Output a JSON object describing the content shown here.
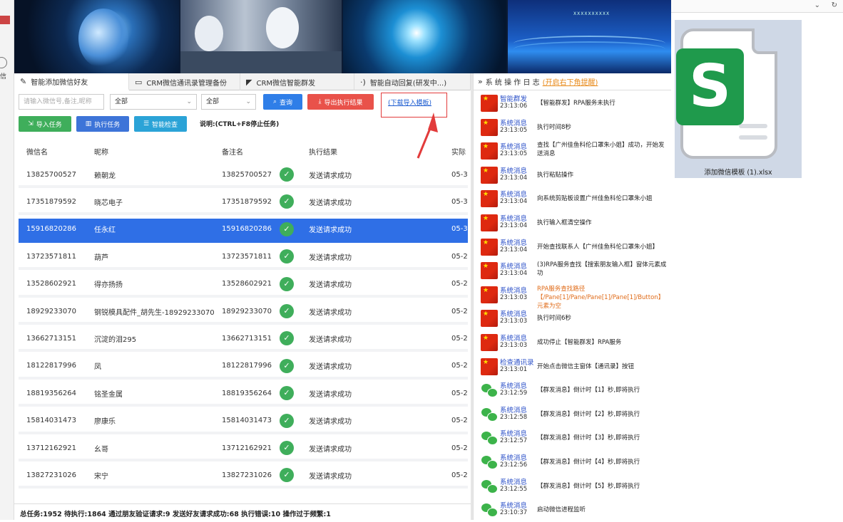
{
  "tabs": [
    {
      "label": "智能添加微信好友",
      "icon": "pencil-icon"
    },
    {
      "label": "CRM微信通讯录管理备份",
      "icon": "book-icon"
    },
    {
      "label": "CRM微信智能群发",
      "icon": "send-icon"
    },
    {
      "label": "智能自动回复(研发中...)",
      "icon": "signal-icon"
    }
  ],
  "toolbar": {
    "search_placeholder": "请输入微信号,备注,昵称",
    "filter1": "全部",
    "filter2": "全部",
    "query": "查询",
    "export": "导出执行结果",
    "download_template": "(下载导入模板)",
    "import": "导入任务",
    "execute": "执行任务",
    "check": "智能检查",
    "hint": "说明:(CTRL+F8停止任务)"
  },
  "grid": {
    "headers": [
      "微信名",
      "昵称",
      "备注名",
      "执行结果",
      "实际"
    ],
    "rows": [
      {
        "wx": "13825700527",
        "nick": "赖朝龙",
        "remark": "13825700527",
        "result": "发送请求成功",
        "time": "05-3"
      },
      {
        "wx": "17351879592",
        "nick": "晓芯电子",
        "remark": "17351879592",
        "result": "发送请求成功",
        "time": "05-3"
      },
      {
        "wx": "15916820286",
        "nick": "任永红",
        "remark": "15916820286",
        "result": "发送请求成功",
        "time": "05-3"
      },
      {
        "wx": "13723571811",
        "nick": "葫芦",
        "remark": "13723571811",
        "result": "发送请求成功",
        "time": "05-2"
      },
      {
        "wx": "13528602921",
        "nick": "得亦扬扬",
        "remark": "13528602921",
        "result": "发送请求成功",
        "time": "05-2"
      },
      {
        "wx": "18929233070",
        "nick": "钢锐模具配件_胡先生-18929233070",
        "remark": "18929233070",
        "result": "发送请求成功",
        "time": "05-2"
      },
      {
        "wx": "13662713151",
        "nick": "沉淀的泪295",
        "remark": "13662713151",
        "result": "发送请求成功",
        "time": "05-2"
      },
      {
        "wx": "18122817996",
        "nick": "凤",
        "remark": "18122817996",
        "result": "发送请求成功",
        "time": "05-2"
      },
      {
        "wx": "18819356264",
        "nick": "铭圣金属",
        "remark": "18819356264",
        "result": "发送请求成功",
        "time": "05-2"
      },
      {
        "wx": "15814031473",
        "nick": "廖康乐",
        "remark": "15814031473",
        "result": "发送请求成功",
        "time": "05-2"
      },
      {
        "wx": "13712162921",
        "nick": "幺哥",
        "remark": "13712162921",
        "result": "发送请求成功",
        "time": "05-2"
      },
      {
        "wx": "13827231026",
        "nick": "宋宁",
        "remark": "13827231026",
        "result": "发送请求成功",
        "time": "05-2"
      }
    ],
    "selected_row": 2
  },
  "status": "总任务:1952 待执行:1864 通过朋友验证请求:9 发送好友请求成功:68 执行错误:10 操作过于频繁:1",
  "log": {
    "title": "系 统 操 作 日 志",
    "note": "(开启右下角提醒)",
    "items": [
      {
        "src": "智能群发",
        "time": "23:13:06",
        "msg": "【智能群发】RPA服务未执行",
        "avatar": "flag"
      },
      {
        "src": "系统消息",
        "time": "23:13:05",
        "msg": "执行时间8秒",
        "avatar": "flag"
      },
      {
        "src": "系统消息",
        "time": "23:13:05",
        "msg": "查找【广州佳鱼科伦口罩朱小姐】成功，开始发送消息",
        "avatar": "flag"
      },
      {
        "src": "系统消息",
        "time": "23:13:04",
        "msg": "执行粘贴操作",
        "avatar": "flag"
      },
      {
        "src": "系统消息",
        "time": "23:13:04",
        "msg": "向系统剪贴板设置广州佳鱼科伦口罩朱小姐",
        "avatar": "flag"
      },
      {
        "src": "系统消息",
        "time": "23:13:04",
        "msg": "执行输入框清空操作",
        "avatar": "flag"
      },
      {
        "src": "系统消息",
        "time": "23:13:04",
        "msg": "开始查找联系人【广州佳鱼科伦口罩朱小姐】",
        "avatar": "flag"
      },
      {
        "src": "系统消息",
        "time": "23:13:04",
        "msg": "(3)RPA服务查找【搜索朋友输入框】窗体元素成功",
        "avatar": "flag"
      },
      {
        "src": "系统消息",
        "time": "23:13:03",
        "msg": "RPA服务查找路径【/Pane[1]/Pane/Pane[1]/Pane[1]/Button】元素为空",
        "avatar": "flag",
        "error": true
      },
      {
        "src": "系统消息",
        "time": "23:13:03",
        "msg": "执行时间6秒",
        "avatar": "flag"
      },
      {
        "src": "系统消息",
        "time": "23:13:03",
        "msg": "成功停止【智能群发】RPA服务",
        "avatar": "flag"
      },
      {
        "src": "检查通讯录",
        "time": "23:13:01",
        "msg": "开始点击微信主窗体【通讯录】按钮",
        "avatar": "flag"
      },
      {
        "src": "系统消息",
        "time": "23:12:59",
        "msg": "【群发消息】倒计时【1】秒,即将执行",
        "avatar": "wechat"
      },
      {
        "src": "系统消息",
        "time": "23:12:58",
        "msg": "【群发消息】倒计时【2】秒,即将执行",
        "avatar": "wechat"
      },
      {
        "src": "系统消息",
        "time": "23:12:57",
        "msg": "【群发消息】倒计时【3】秒,即将执行",
        "avatar": "wechat"
      },
      {
        "src": "系统消息",
        "time": "23:12:56",
        "msg": "【群发消息】倒计时【4】秒,即将执行",
        "avatar": "wechat"
      },
      {
        "src": "系统消息",
        "time": "23:12:55",
        "msg": "【群发消息】倒计时【5】秒,即将执行",
        "avatar": "wechat"
      },
      {
        "src": "系统消息",
        "time": "23:10:37",
        "msg": "启动微信进程监听",
        "avatar": "wechat"
      }
    ]
  },
  "desktop": {
    "left_label": "信",
    "file_name": "添加微信模板 (1).xlsx",
    "file_icon_letter": "S"
  },
  "banner_label": "XXXXXXXXXX"
}
